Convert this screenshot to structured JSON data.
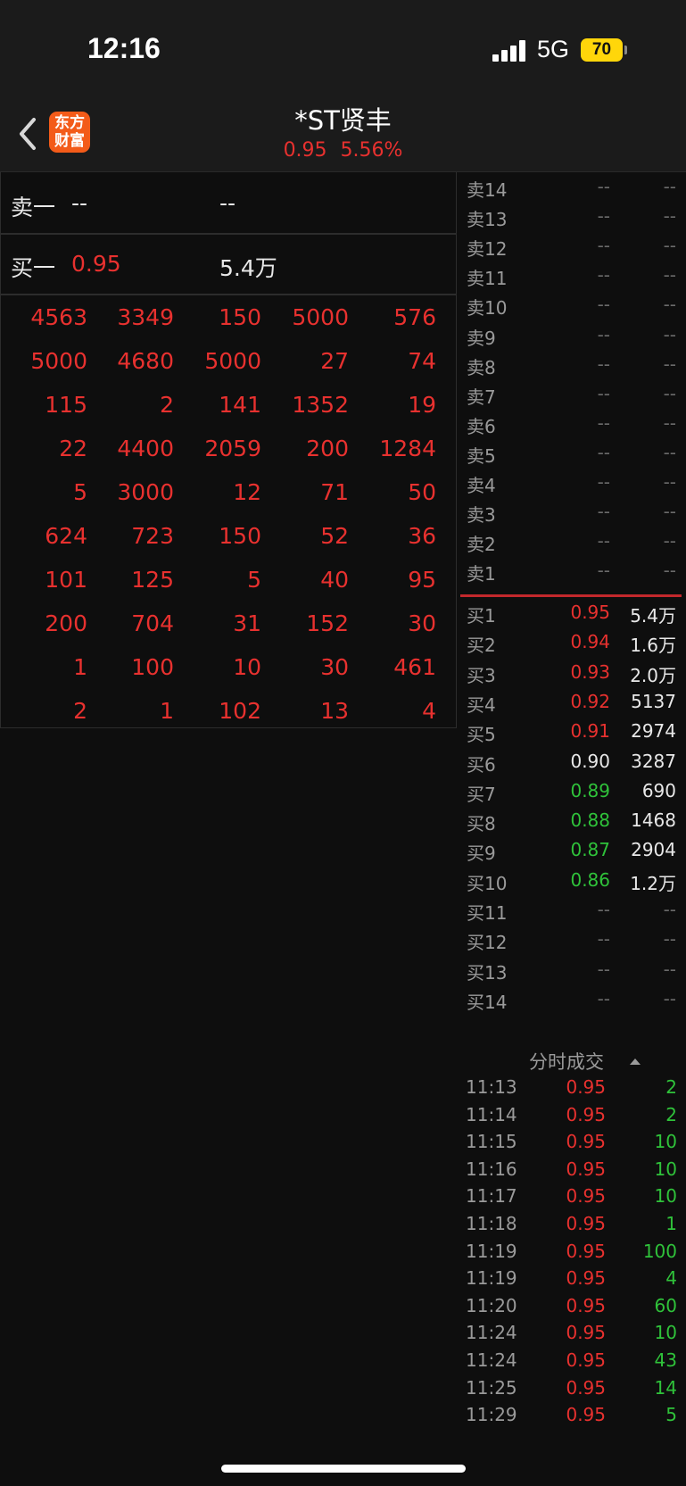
{
  "status_bar": {
    "time": "12:16",
    "network": "5G",
    "battery": "70"
  },
  "header": {
    "title": "*ST贤丰",
    "price": "0.95",
    "change_pct": "5.56%",
    "logo_line1": "东方",
    "logo_line2": "财富"
  },
  "quote": {
    "sell_label": "卖一",
    "sell_price": "--",
    "sell_volume": "--",
    "buy_label": "买一",
    "buy_price": "0.95",
    "buy_volume": "5.4万"
  },
  "trade_grid": [
    [
      "4563",
      "3349",
      "150",
      "5000",
      "576"
    ],
    [
      "5000",
      "4680",
      "5000",
      "27",
      "74"
    ],
    [
      "115",
      "2",
      "141",
      "1352",
      "19"
    ],
    [
      "22",
      "4400",
      "2059",
      "200",
      "1284"
    ],
    [
      "5",
      "3000",
      "12",
      "71",
      "50"
    ],
    [
      "624",
      "723",
      "150",
      "52",
      "36"
    ],
    [
      "101",
      "125",
      "5",
      "40",
      "95"
    ],
    [
      "200",
      "704",
      "31",
      "152",
      "30"
    ],
    [
      "1",
      "100",
      "10",
      "30",
      "461"
    ],
    [
      "2",
      "1",
      "102",
      "13",
      "4"
    ]
  ],
  "order_book": {
    "asks": [
      {
        "label": "卖14",
        "price": "--",
        "volume": "--",
        "color": "dash"
      },
      {
        "label": "卖13",
        "price": "--",
        "volume": "--",
        "color": "dash"
      },
      {
        "label": "卖12",
        "price": "--",
        "volume": "--",
        "color": "dash"
      },
      {
        "label": "卖11",
        "price": "--",
        "volume": "--",
        "color": "dash"
      },
      {
        "label": "卖10",
        "price": "--",
        "volume": "--",
        "color": "dash"
      },
      {
        "label": "卖9",
        "price": "--",
        "volume": "--",
        "color": "dash"
      },
      {
        "label": "卖8",
        "price": "--",
        "volume": "--",
        "color": "dash"
      },
      {
        "label": "卖7",
        "price": "--",
        "volume": "--",
        "color": "dash"
      },
      {
        "label": "卖6",
        "price": "--",
        "volume": "--",
        "color": "dash"
      },
      {
        "label": "卖5",
        "price": "--",
        "volume": "--",
        "color": "dash"
      },
      {
        "label": "卖4",
        "price": "--",
        "volume": "--",
        "color": "dash"
      },
      {
        "label": "卖3",
        "price": "--",
        "volume": "--",
        "color": "dash"
      },
      {
        "label": "卖2",
        "price": "--",
        "volume": "--",
        "color": "dash"
      },
      {
        "label": "卖1",
        "price": "--",
        "volume": "--",
        "color": "dash"
      }
    ],
    "bids": [
      {
        "label": "买1",
        "price": "0.95",
        "volume": "5.4万",
        "color": "red"
      },
      {
        "label": "买2",
        "price": "0.94",
        "volume": "1.6万",
        "color": "red"
      },
      {
        "label": "买3",
        "price": "0.93",
        "volume": "2.0万",
        "color": "red"
      },
      {
        "label": "买4",
        "price": "0.92",
        "volume": "5137",
        "color": "red"
      },
      {
        "label": "买5",
        "price": "0.91",
        "volume": "2974",
        "color": "red"
      },
      {
        "label": "买6",
        "price": "0.90",
        "volume": "3287",
        "color": "white"
      },
      {
        "label": "买7",
        "price": "0.89",
        "volume": "690",
        "color": "green"
      },
      {
        "label": "买8",
        "price": "0.88",
        "volume": "1468",
        "color": "green"
      },
      {
        "label": "买9",
        "price": "0.87",
        "volume": "2904",
        "color": "green"
      },
      {
        "label": "买10",
        "price": "0.86",
        "volume": "1.2万",
        "color": "green"
      },
      {
        "label": "买11",
        "price": "--",
        "volume": "--",
        "color": "dash"
      },
      {
        "label": "买12",
        "price": "--",
        "volume": "--",
        "color": "dash"
      },
      {
        "label": "买13",
        "price": "--",
        "volume": "--",
        "color": "dash"
      },
      {
        "label": "买14",
        "price": "--",
        "volume": "--",
        "color": "dash"
      }
    ]
  },
  "ticks": {
    "title": "分时成交",
    "rows": [
      {
        "time": "11:13",
        "price": "0.95",
        "volume": "2"
      },
      {
        "time": "11:14",
        "price": "0.95",
        "volume": "2"
      },
      {
        "time": "11:15",
        "price": "0.95",
        "volume": "10"
      },
      {
        "time": "11:16",
        "price": "0.95",
        "volume": "10"
      },
      {
        "time": "11:17",
        "price": "0.95",
        "volume": "10"
      },
      {
        "time": "11:18",
        "price": "0.95",
        "volume": "1"
      },
      {
        "time": "11:19",
        "price": "0.95",
        "volume": "100"
      },
      {
        "time": "11:19",
        "price": "0.95",
        "volume": "4"
      },
      {
        "time": "11:20",
        "price": "0.95",
        "volume": "60"
      },
      {
        "time": "11:24",
        "price": "0.95",
        "volume": "10"
      },
      {
        "time": "11:24",
        "price": "0.95",
        "volume": "43"
      },
      {
        "time": "11:25",
        "price": "0.95",
        "volume": "14"
      },
      {
        "time": "11:29",
        "price": "0.95",
        "volume": "5"
      }
    ]
  },
  "colors": {
    "up": "#e8312f",
    "down": "#2fc23a",
    "logo": "#f35b19",
    "battery": "#ffd60a"
  }
}
